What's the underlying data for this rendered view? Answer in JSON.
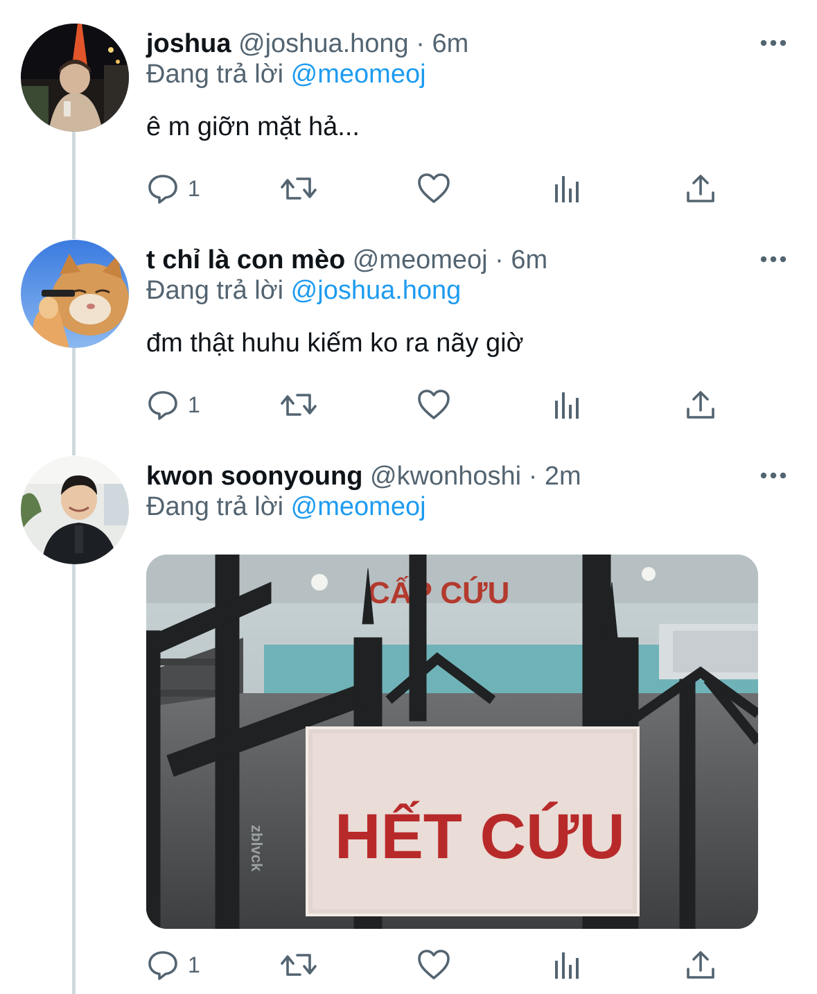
{
  "reply_prefix": "Đang trả lời",
  "tweets": [
    {
      "name": "joshua",
      "handle": "@joshua.hong",
      "time": "6m",
      "reply_to": "@meomeoj",
      "text": "ê m giỡn mặt hả...",
      "reply_count": "1"
    },
    {
      "name": "t chỉ là con mèo",
      "handle": "@meomeoj",
      "time": "6m",
      "reply_to": "@joshua.hong",
      "text": "đm thật huhu kiếm ko ra nãy giờ",
      "reply_count": "1"
    },
    {
      "name": "kwon soonyoung",
      "handle": "@kwonhoshi",
      "time": "2m",
      "reply_to": "@meomeoj",
      "reply_count": "1",
      "image": {
        "top_sign": "CẤP CỨU",
        "sign": "HẾT CỨU",
        "pole_text": "zblvck"
      }
    }
  ],
  "icons": {
    "reply": "reply-bubble-icon",
    "retweet": "retweet-icon",
    "like": "heart-icon",
    "views": "analytics-icon",
    "share": "share-icon",
    "more": "more-dots-icon"
  },
  "colors": {
    "text": "#0f1419",
    "secondary": "#536471",
    "link": "#1d9bf0",
    "thread_line": "#cfd9de"
  }
}
